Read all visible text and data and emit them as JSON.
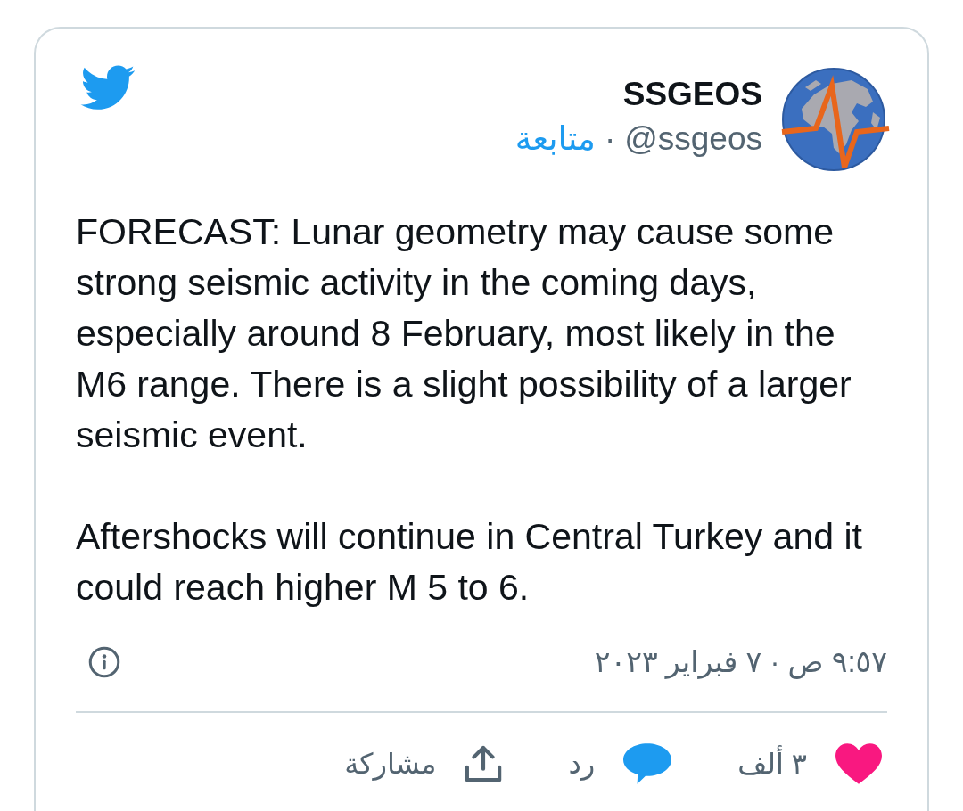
{
  "tweet": {
    "author": {
      "name": "SSGEOS",
      "handle": "@ssgeos",
      "separator": "·",
      "follow": "متابعة"
    },
    "paragraphs": [
      "FORECAST: Lunar geometry may cause some strong seismic activity in the coming days, especially around 8 February, most likely in the M6 range. There is a slight possibility of a larger seismic event.",
      "Aftershocks will continue in Central Turkey and it could reach higher M 5 to 6."
    ],
    "timestamp": "٩:٥٧ ص · ٧ فبراير ٢٠٢٣",
    "actions": [
      {
        "kind": "like",
        "label": "٣ ألف"
      },
      {
        "kind": "reply",
        "label": "رد"
      },
      {
        "kind": "share",
        "label": "مشاركة"
      }
    ]
  }
}
